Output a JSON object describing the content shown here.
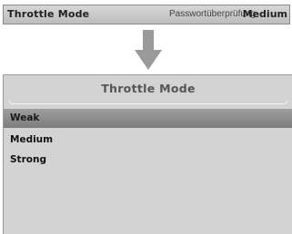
{
  "before": {
    "label": "Throttle Mode",
    "overlay": "Passwortüberprüfung",
    "value": "Medium"
  },
  "arrow_icon": "arrow-down-icon",
  "menu": {
    "title": "Throttle Mode",
    "items": [
      {
        "label": "Weak",
        "selected": true
      },
      {
        "label": "Medium",
        "selected": false
      },
      {
        "label": "Strong",
        "selected": false
      }
    ]
  },
  "colors": {
    "bar_bg": "#c8c8c8",
    "panel_bg": "#d3d3d3",
    "selected_bg": "#8a8a8a",
    "arrow": "#9a9a9a"
  }
}
